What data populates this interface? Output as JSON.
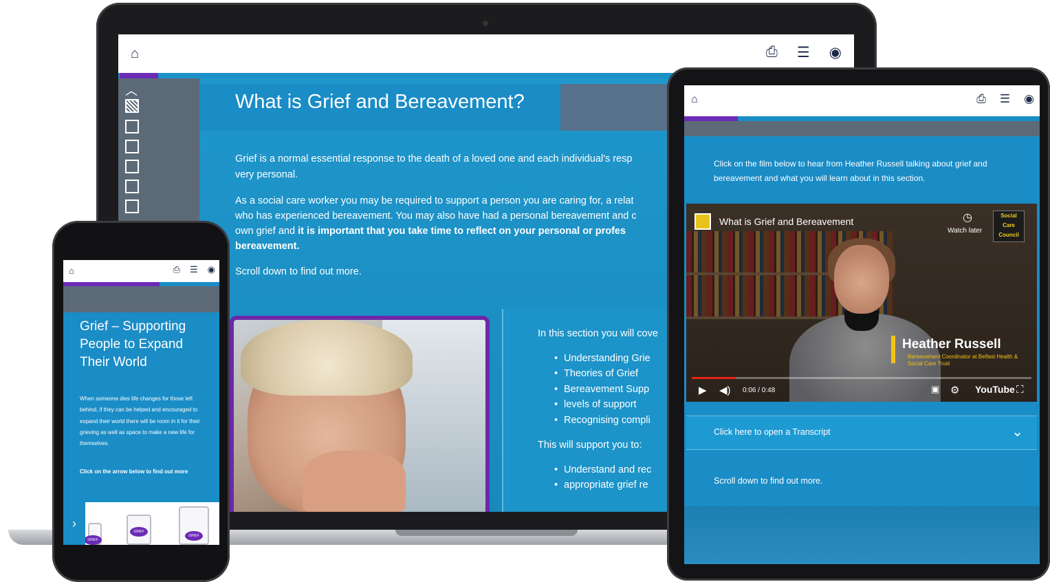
{
  "laptop": {
    "toolbar": {
      "home_icon": "home-icon",
      "print_icon": "printer-icon",
      "menu_icon": "list-icon",
      "view_icon": "eye-icon"
    },
    "title": "What is Grief and Bereavement?",
    "para1_line1": "Grief is a normal essential response to the death of a loved one and each individual's resp",
    "para1_line2": "very personal.",
    "para2_line1": "As a social care worker you may be required to support a person you are caring for, a relat",
    "para2_line2": "who has experienced bereavement. You may also have had a personal bereavement and c",
    "para2_line3_plain": "own grief and ",
    "para2_line3_bold": "it is important that you take time to reflect on your personal or profes",
    "para2_line4_bold": "bereavement.",
    "scroll": "Scroll down to find out more.",
    "panel": {
      "intro": "In this section you will cove",
      "items": [
        "Understanding Grie",
        "Theories of Grief",
        "Bereavement Supp",
        "levels of support",
        "Recognising compli"
      ],
      "support": "This will support you to:",
      "support_items": [
        "Understand and rec",
        "appropriate grief re"
      ]
    }
  },
  "phone": {
    "title": "Grief – Supporting People to Expand Their World",
    "body": "When someone dies life changes for those left behind, if they can be helped and encouraged to expand their world there will be room in it for their grieving as well as space to make a new life for themselves.",
    "cta": "Click on the arrow below to find out more",
    "jar_labels": [
      "GRIEF",
      "GRIEF",
      "GRIEF"
    ]
  },
  "tablet": {
    "intro": "Click on the film below to hear from Heather Russell talking about grief and bereavement and what you will learn about in this section.",
    "video": {
      "title": "What is Grief and Bereavement",
      "watch_later": "Watch later",
      "badge_lines": [
        "Social",
        "Care",
        "Council"
      ],
      "speaker_name": "Heather Russell",
      "speaker_role": "Bereavement Coordinator at Belfast Health & Social Care Trust",
      "time": "0:06 / 0:48",
      "provider": "YouTube",
      "progress": 0.13
    },
    "transcript": "Click here to open a Transcript",
    "scroll": "Scroll down to find out more."
  },
  "colors": {
    "brand_blue": "#1a8cc6",
    "progress_purple": "#6c2bb6",
    "sidebar_grey": "#5c6a78"
  }
}
